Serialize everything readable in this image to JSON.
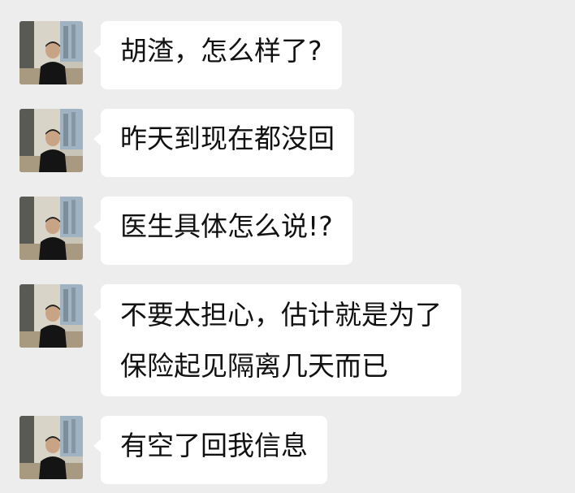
{
  "conversation": {
    "messages": [
      {
        "text": "胡渣，怎么样了?"
      },
      {
        "text": "昨天到现在都没回"
      },
      {
        "text": "医生具体怎么说!?"
      },
      {
        "text": "不要太担心，估计就是为了\n保险起见隔离几天而已"
      },
      {
        "text": "有空了回我信息"
      }
    ]
  },
  "colors": {
    "background": "#ededed",
    "bubble": "#ffffff",
    "text": "#111111"
  }
}
